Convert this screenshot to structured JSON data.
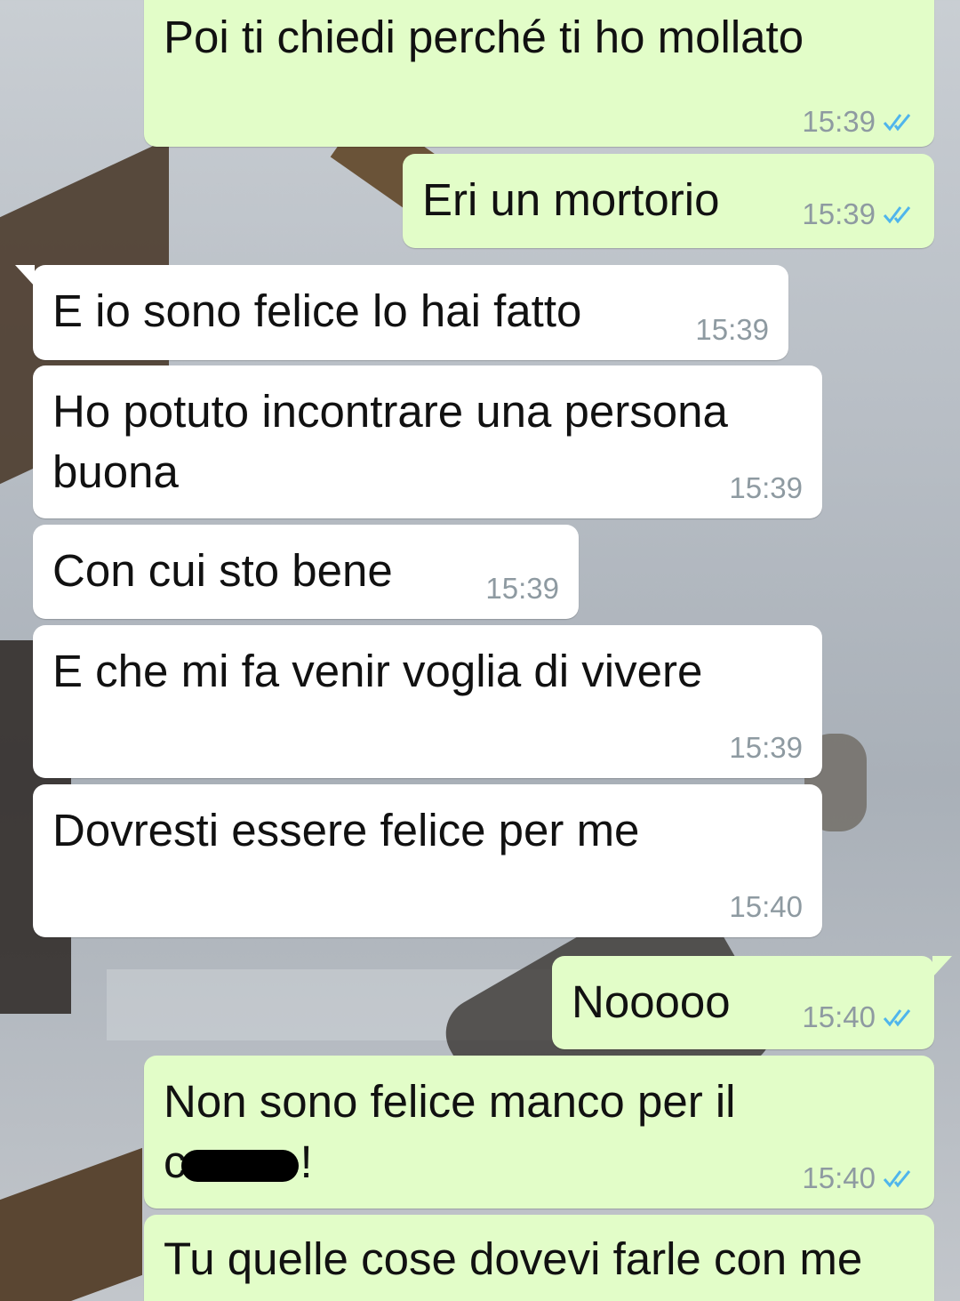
{
  "chat": {
    "messages": [
      {
        "id": "m1",
        "direction": "outgoing",
        "text": "Poi ti chiedi perché ti ho mollato",
        "time": "15:39",
        "status": "read"
      },
      {
        "id": "m2",
        "direction": "outgoing",
        "text": "Eri un mortorio",
        "time": "15:39",
        "status": "read"
      },
      {
        "id": "m3",
        "direction": "incoming",
        "text": "E io sono felice lo hai fatto",
        "time": "15:39"
      },
      {
        "id": "m4",
        "direction": "incoming",
        "text": "Ho potuto incontrare una persona\nbuona",
        "time": "15:39"
      },
      {
        "id": "m5",
        "direction": "incoming",
        "text": "Con cui sto bene",
        "time": "15:39"
      },
      {
        "id": "m6",
        "direction": "incoming",
        "text": "E che mi fa venir voglia di vivere",
        "time": "15:39"
      },
      {
        "id": "m7",
        "direction": "incoming",
        "text": "Dovresti essere felice per me",
        "time": "15:40"
      },
      {
        "id": "m8",
        "direction": "outgoing",
        "text": "Nooooo",
        "time": "15:40",
        "status": "read"
      },
      {
        "id": "m9",
        "direction": "outgoing",
        "text_line1": "Non sono felice manco per il",
        "text_line2_prefix": "c",
        "text_line2_suffix": "!",
        "redacted": true,
        "time": "15:40",
        "status": "read"
      },
      {
        "id": "m10",
        "direction": "outgoing",
        "text": "Tu quelle cose dovevi farle con me",
        "time": "",
        "status": ""
      }
    ]
  },
  "colors": {
    "outgoing_bubble": "#e2fdc8",
    "incoming_bubble": "#ffffff",
    "read_ticks": "#4fb5ec",
    "meta_text": "#8e9aa1"
  },
  "icons": {
    "read_receipt": "double-check-icon"
  }
}
